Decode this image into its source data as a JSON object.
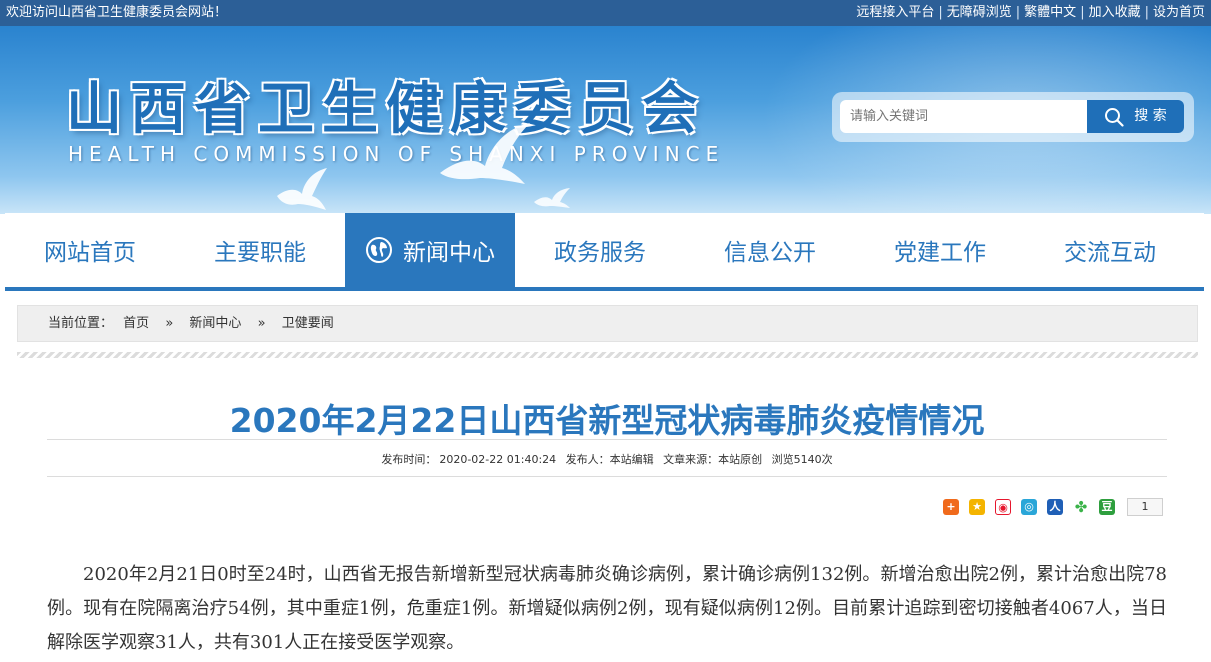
{
  "topbar": {
    "welcome": "欢迎访问山西省卫生健康委员会网站！",
    "links": [
      "远程接入平台",
      "无障碍浏览",
      "繁體中文",
      "加入收藏",
      "设为首页"
    ],
    "separator": "|"
  },
  "header": {
    "title_cn": "山西省卫生健康委员会",
    "title_en": "HEALTH COMMISSION OF SHANXI PROVINCE",
    "search": {
      "placeholder": "请输入关键词",
      "button_label": "搜 索",
      "button_icon": "search-icon"
    }
  },
  "nav": {
    "items": [
      {
        "label": "网站首页",
        "active": false
      },
      {
        "label": "主要职能",
        "active": false
      },
      {
        "label": "新闻中心",
        "active": true,
        "icon": "globe-icon"
      },
      {
        "label": "政务服务",
        "active": false
      },
      {
        "label": "信息公开",
        "active": false
      },
      {
        "label": "党建工作",
        "active": false
      },
      {
        "label": "交流互动",
        "active": false
      }
    ]
  },
  "breadcrumb": {
    "prefix": "当前位置：",
    "items": [
      "首页",
      "新闻中心",
      "卫健要闻"
    ],
    "separator": "»"
  },
  "article": {
    "title": "2020年2月22日山西省新型冠状病毒肺炎疫情情况",
    "meta": {
      "published_label": "发布时间：",
      "published": "2020-02-22 01:40:24",
      "publisher": "发布人：本站编辑",
      "source": "文章来源：本站原创",
      "views": "浏览5140次"
    },
    "share": {
      "icons": [
        "plus-share-icon",
        "qzone-star-icon",
        "weibo-icon",
        "tencent-weibo-icon",
        "renren-icon",
        "kaixin-clover-icon",
        "douban-icon"
      ],
      "count": "1"
    },
    "body": "2020年2月21日0时至24时，山西省无报告新增新型冠状病毒肺炎确诊病例，累计确诊病例132例。新增治愈出院2例，累计治愈出院78例。现有在院隔离治疗54例，其中重症1例，危重症1例。新增疑似病例2例，现有疑似病例12例。目前累计追踪到密切接触者4067人，当日解除医学观察31人，共有301人正在接受医学观察。"
  },
  "colors": {
    "topbar": "#2c5f97",
    "accent_blue": "#2a77bd",
    "breadcrumb_bg": "#efefef"
  }
}
